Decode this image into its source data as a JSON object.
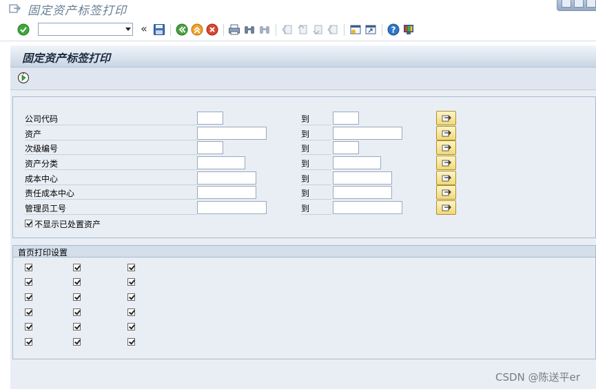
{
  "window": {
    "title": "固定资产标签打印"
  },
  "toolbar": {
    "command_value": "",
    "back_glyph": "«"
  },
  "screen": {
    "heading": "固定资产标签打印"
  },
  "selection": {
    "to_label": "到",
    "rows": [
      {
        "label": "公司代码"
      },
      {
        "label": "资产"
      },
      {
        "label": "次级编号"
      },
      {
        "label": "资产分类"
      },
      {
        "label": "成本中心"
      },
      {
        "label": "责任成本中心"
      },
      {
        "label": "管理员工号"
      }
    ],
    "hide_disposed": {
      "label": "不显示已处置资产",
      "checked": true
    }
  },
  "first_page": {
    "title": "首页打印设置",
    "rows": 6,
    "cols": 3,
    "checked": true
  },
  "watermark": "CSDN @陈送平er"
}
